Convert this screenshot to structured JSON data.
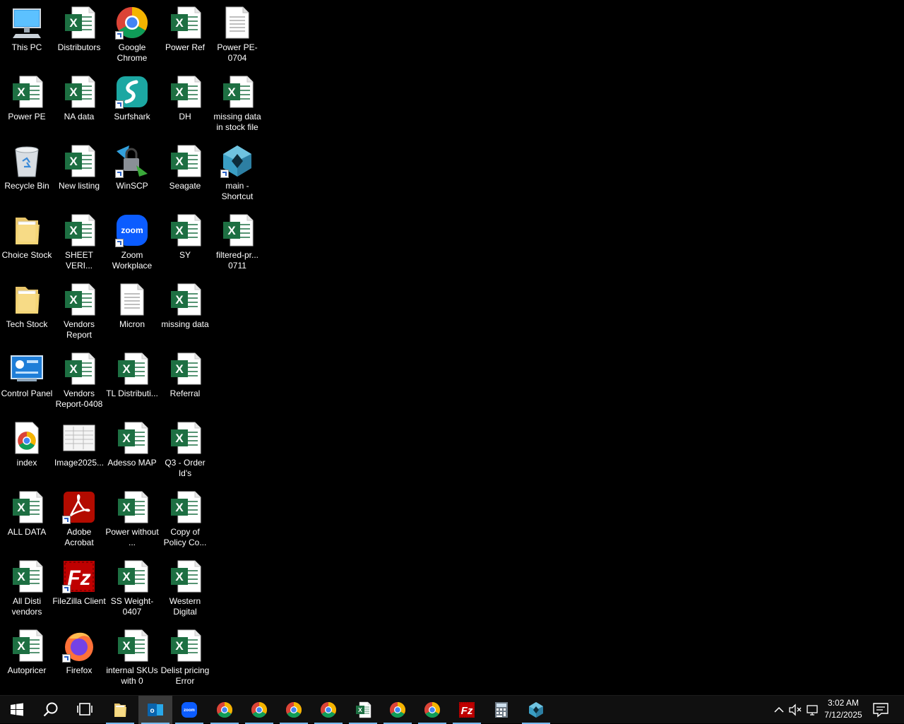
{
  "desktop": {
    "icons": [
      {
        "label": "This PC",
        "icon": "pc-icon"
      },
      {
        "label": "Distributors",
        "icon": "excel-icon"
      },
      {
        "label": "Google Chrome",
        "icon": "chrome-icon",
        "shortcut": true
      },
      {
        "label": "Power Ref",
        "icon": "excel-icon"
      },
      {
        "label": "Power PE-0704",
        "icon": "text-file-icon"
      },
      {
        "label": "Power PE",
        "icon": "excel-icon"
      },
      {
        "label": "NA data",
        "icon": "excel-icon"
      },
      {
        "label": "Surfshark",
        "icon": "surfshark-icon",
        "shortcut": true
      },
      {
        "label": "DH",
        "icon": "excel-icon"
      },
      {
        "label": "missing data in stock file",
        "icon": "excel-icon"
      },
      {
        "label": "Recycle Bin",
        "icon": "recycle-bin-icon"
      },
      {
        "label": "New listing",
        "icon": "excel-icon"
      },
      {
        "label": "WinSCP",
        "icon": "winscp-icon",
        "shortcut": true
      },
      {
        "label": "Seagate",
        "icon": "excel-icon"
      },
      {
        "label": "main - Shortcut",
        "icon": "app-diamond-icon",
        "shortcut": true
      },
      {
        "label": "Choice Stock",
        "icon": "folder-icon"
      },
      {
        "label": "SHEET VERI...",
        "icon": "excel-icon"
      },
      {
        "label": "Zoom Workplace",
        "icon": "zoom-icon",
        "shortcut": true
      },
      {
        "label": "SY",
        "icon": "excel-icon"
      },
      {
        "label": "filtered-pr... 0711",
        "icon": "excel-icon"
      },
      {
        "label": "Tech Stock",
        "icon": "folder-icon"
      },
      {
        "label": "Vendors Report",
        "icon": "excel-icon"
      },
      {
        "label": "Micron",
        "icon": "text-file-icon"
      },
      {
        "label": "missing data",
        "icon": "excel-icon"
      },
      {
        "label": "Control Panel",
        "icon": "control-panel-icon"
      },
      {
        "label": "Vendors Report-0408",
        "icon": "excel-icon"
      },
      {
        "label": "TL Distributi...",
        "icon": "excel-icon"
      },
      {
        "label": "Referral",
        "icon": "excel-icon"
      },
      {
        "label": "index",
        "icon": "chrome-html-icon"
      },
      {
        "label": "Image2025...",
        "icon": "image-file-icon"
      },
      {
        "label": "Adesso MAP",
        "icon": "excel-icon"
      },
      {
        "label": "Q3 - Order Id's",
        "icon": "excel-icon"
      },
      {
        "label": "ALL DATA",
        "icon": "excel-icon"
      },
      {
        "label": "Adobe Acrobat",
        "icon": "acrobat-icon",
        "shortcut": true
      },
      {
        "label": "Power without ...",
        "icon": "excel-icon"
      },
      {
        "label": "Copy of Policy Co...",
        "icon": "excel-icon"
      },
      {
        "label": "All Disti vendors",
        "icon": "excel-icon"
      },
      {
        "label": "FileZilla Client",
        "icon": "filezilla-icon",
        "shortcut": true
      },
      {
        "label": "SS Weight-0407",
        "icon": "excel-icon"
      },
      {
        "label": "Western Digital",
        "icon": "excel-icon"
      },
      {
        "label": "Autopricer",
        "icon": "excel-icon"
      },
      {
        "label": "Firefox",
        "icon": "firefox-icon",
        "shortcut": true
      },
      {
        "label": "internal SKUs with 0",
        "icon": "excel-icon"
      },
      {
        "label": "Delist pricing Error",
        "icon": "excel-icon"
      }
    ]
  },
  "taskbar": {
    "buttons": [
      {
        "name": "start-button",
        "icon": "windows-logo-icon"
      },
      {
        "name": "search-button",
        "icon": "search-icon"
      },
      {
        "name": "task-view-button",
        "icon": "task-view-icon"
      },
      {
        "name": "file-explorer-button",
        "icon": "folder-icon"
      },
      {
        "name": "outlook-button",
        "icon": "outlook-icon"
      },
      {
        "name": "zoom-taskbar-button",
        "icon": "zoom-icon"
      },
      {
        "name": "chrome-profile-1-button",
        "icon": "chrome-icon"
      },
      {
        "name": "chrome-profile-2-button",
        "icon": "chrome-icon"
      },
      {
        "name": "chrome-profile-3-button",
        "icon": "chrome-icon"
      },
      {
        "name": "chrome-profile-4-button",
        "icon": "chrome-icon"
      },
      {
        "name": "excel-taskbar-button",
        "icon": "excel-icon"
      },
      {
        "name": "chrome-profile-5-button",
        "icon": "chrome-icon"
      },
      {
        "name": "chrome-profile-6-button",
        "icon": "chrome-icon"
      },
      {
        "name": "filezilla-taskbar-button",
        "icon": "filezilla-icon"
      },
      {
        "name": "calculator-button",
        "icon": "calculator-icon"
      },
      {
        "name": "app-diamond-taskbar-button",
        "icon": "app-diamond-icon"
      }
    ],
    "tray": {
      "time": "3:02 AM",
      "date": "7/12/2025"
    }
  }
}
